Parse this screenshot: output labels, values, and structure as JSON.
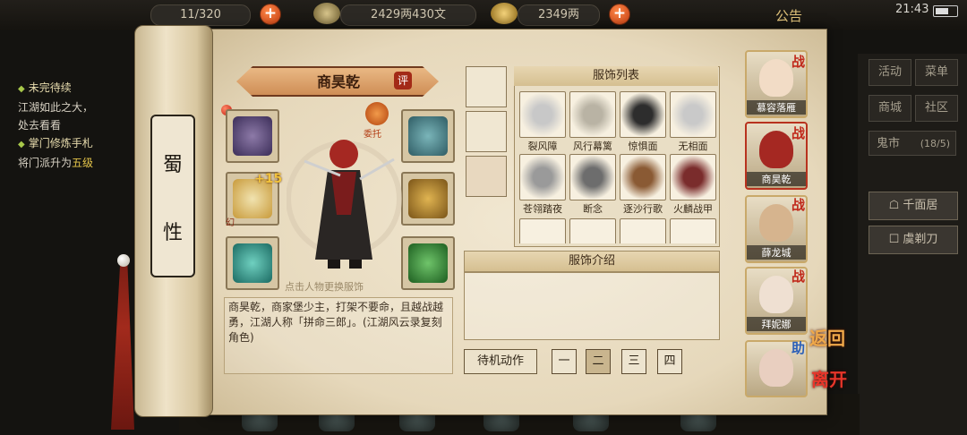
{
  "top": {
    "resource1": "11/320",
    "silver": "2429两430文",
    "gold": "2349两",
    "announcement": "公告",
    "clock": "21:43"
  },
  "quest": {
    "title1": "未完待续",
    "line1a": "江湖如此之大，",
    "line1b": "处去看看",
    "title2": "掌门修炼手札",
    "line2a": "将门派升为",
    "line2b": "五级"
  },
  "menu": {
    "activity": "活动",
    "menu": "菜单",
    "shop": "商城",
    "community": "社区",
    "market": "鬼市",
    "market_count": "(18/5)",
    "qianmianju": "千面居",
    "xueyindao": "虞剃刀"
  },
  "scroll_label": {
    "char1": "蜀",
    "char2": "性"
  },
  "character": {
    "name": "商昊乾",
    "rate_badge": "评",
    "enhance": "+15",
    "illusion": "幻",
    "entrust": "委托",
    "hint": "点击人物更换服饰",
    "description": "商昊乾，商家堡少主，打架不要命，且越战越勇，江湖人称「拼命三郎」。(江湖风云录复刻角色)"
  },
  "outfits": {
    "title": "服饰列表",
    "items": [
      {
        "name": "裂风障",
        "color": "#c8c8c8"
      },
      {
        "name": "风行幕篱",
        "color": "#b9b3a4"
      },
      {
        "name": "惊惧面",
        "color": "#2d2d2d"
      },
      {
        "name": "无相面",
        "color": "#c9c9c9"
      },
      {
        "name": "苍翎踏夜",
        "color": "#9a9a9a"
      },
      {
        "name": "断念",
        "color": "#6d6d6d"
      },
      {
        "name": "逐沙行歌",
        "color": "#8a5a34"
      },
      {
        "name": "火麟战甲",
        "color": "#7a2c2c"
      }
    ],
    "intro_title": "服饰介绍"
  },
  "actions": {
    "idle_label": "待机动作",
    "options": [
      "一",
      "二",
      "三",
      "四"
    ],
    "selected_index": 1
  },
  "roster": [
    {
      "name": "慕容落雁",
      "tag": "战"
    },
    {
      "name": "商昊乾",
      "tag": "战"
    },
    {
      "name": "薛龙城",
      "tag": "战"
    },
    {
      "name": "拜妮娜",
      "tag": "战"
    },
    {
      "name": "",
      "tag": "助"
    }
  ],
  "nav": {
    "back": "返回",
    "leave": "离开"
  },
  "colors": {
    "accent_red": "#b8321e",
    "parchment": "#ece0c6",
    "gold": "#f2c33c"
  }
}
